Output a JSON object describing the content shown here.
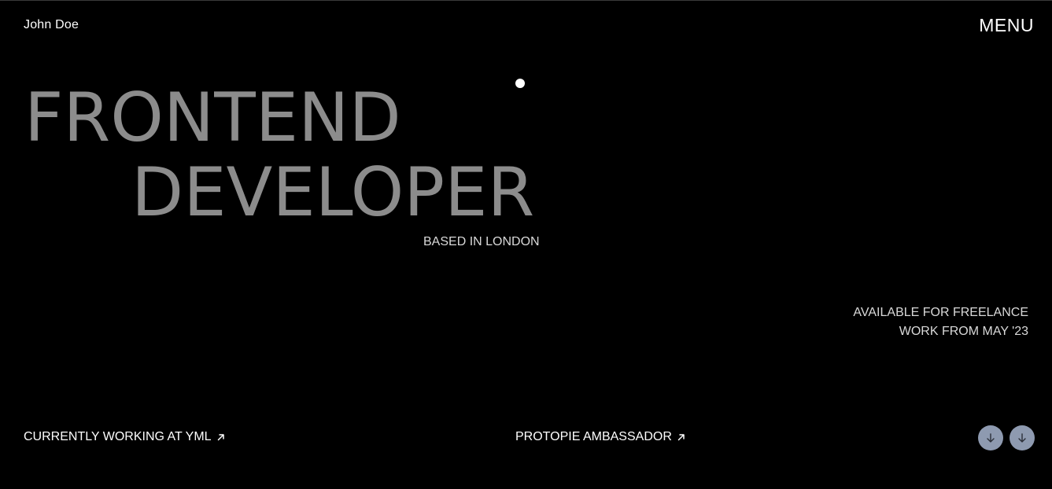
{
  "header": {
    "brand": "John Doe",
    "menu_label": "MENU"
  },
  "hero": {
    "line1": "FRONTEND",
    "line2": "DEVELOPER",
    "location": "BASED IN LONDON"
  },
  "availability": {
    "line1": "AVAILABLE FOR FREELANCE",
    "line2": "WORK FROM MAY '23"
  },
  "footer_links": {
    "yml": "CURRENTLY WORKING AT YML",
    "protopie": "PROTOPIE AMBASSADOR"
  },
  "icons": {
    "external_link": "arrow-up-right-icon",
    "scroll_down": "arrow-down-icon"
  },
  "colors": {
    "background": "#000000",
    "hero_text": "#8c8c8c",
    "scroll_button": "#8e9ab0"
  }
}
